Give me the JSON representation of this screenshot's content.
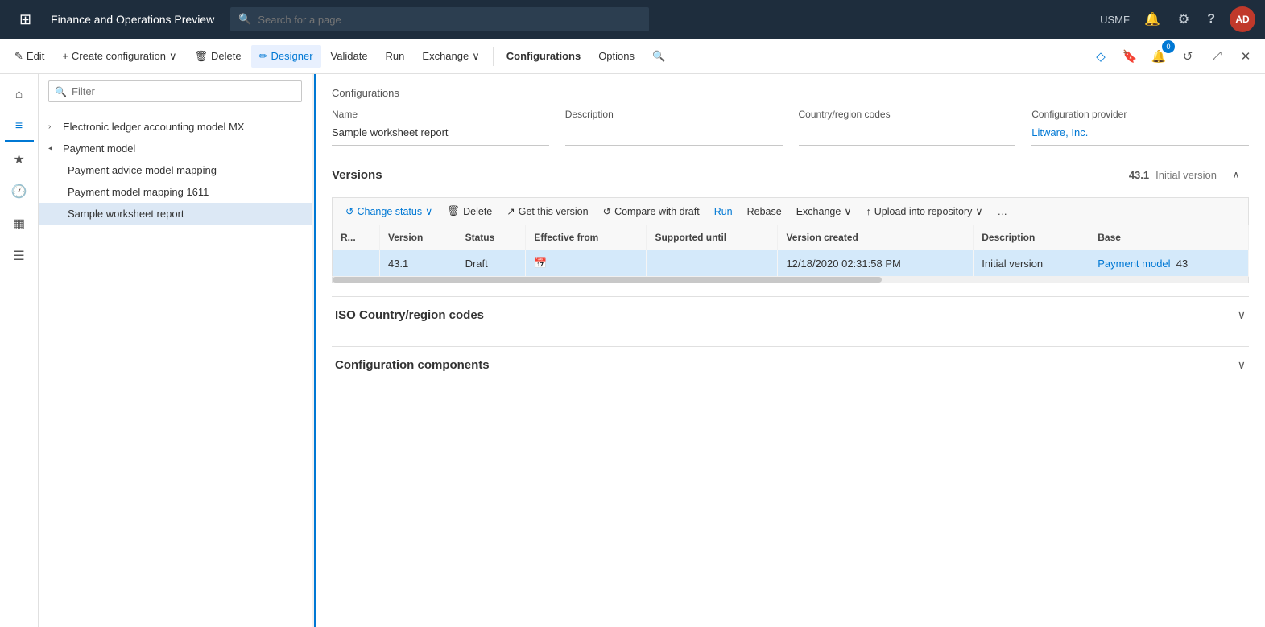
{
  "app": {
    "title": "Finance and Operations Preview",
    "search_placeholder": "Search for a page",
    "user_region": "USMF",
    "user_initials": "AD"
  },
  "toolbar": {
    "edit_label": "Edit",
    "create_label": "Create configuration",
    "delete_label": "Delete",
    "designer_label": "Designer",
    "validate_label": "Validate",
    "run_label": "Run",
    "exchange_label": "Exchange",
    "configurations_label": "Configurations",
    "options_label": "Options"
  },
  "tree": {
    "filter_placeholder": "Filter",
    "items": [
      {
        "label": "Electronic ledger accounting model MX",
        "level": 0,
        "expandable": true,
        "expanded": false
      },
      {
        "label": "Payment model",
        "level": 0,
        "expandable": true,
        "expanded": true
      },
      {
        "label": "Payment advice model mapping",
        "level": 1,
        "expandable": false
      },
      {
        "label": "Payment model mapping 1611",
        "level": 1,
        "expandable": false
      },
      {
        "label": "Sample worksheet report",
        "level": 1,
        "expandable": false,
        "selected": true
      }
    ]
  },
  "configurations": {
    "breadcrumb": "Configurations",
    "fields": {
      "name_label": "Name",
      "name_value": "Sample worksheet report",
      "description_label": "Description",
      "description_value": "",
      "country_label": "Country/region codes",
      "country_value": "",
      "provider_label": "Configuration provider",
      "provider_value": "Litware, Inc."
    }
  },
  "versions": {
    "section_title": "Versions",
    "version_number": "43.1",
    "version_label": "Initial version",
    "toolbar": {
      "change_status_label": "Change status",
      "delete_label": "Delete",
      "get_version_label": "Get this version",
      "compare_label": "Compare with draft",
      "run_label": "Run",
      "rebase_label": "Rebase",
      "exchange_label": "Exchange",
      "upload_label": "Upload into repository"
    },
    "table": {
      "columns": [
        "R...",
        "Version",
        "Status",
        "Effective from",
        "Supported until",
        "Version created",
        "Description",
        "Base"
      ],
      "rows": [
        {
          "r": "",
          "version": "43.1",
          "status": "Draft",
          "effective_from": "",
          "supported_until": "",
          "version_created": "12/18/2020 02:31:58 PM",
          "description": "Initial version",
          "base": "Payment model",
          "base_num": "43"
        }
      ]
    }
  },
  "sections": {
    "iso_title": "ISO Country/region codes",
    "components_title": "Configuration components"
  },
  "icons": {
    "grid": "⊞",
    "search": "🔍",
    "bell": "🔔",
    "gear": "⚙",
    "question": "?",
    "home": "⌂",
    "star": "★",
    "clock": "🕐",
    "table": "▦",
    "list": "≡",
    "filter": "⊻",
    "edit": "✎",
    "plus": "+",
    "trash": "🗑",
    "designer": "✏",
    "check": "✓",
    "play": "▶",
    "exchange": "⇄",
    "upload": "↑",
    "refresh": "↺",
    "chevron_down": "∨",
    "chevron_up": "∧",
    "chevron_right": "›",
    "calendar": "📅",
    "more": "…",
    "collapse": "∧",
    "maximize": "⤢",
    "close": "✕",
    "back": "←",
    "nav_right": "→"
  },
  "notification_count": "0"
}
